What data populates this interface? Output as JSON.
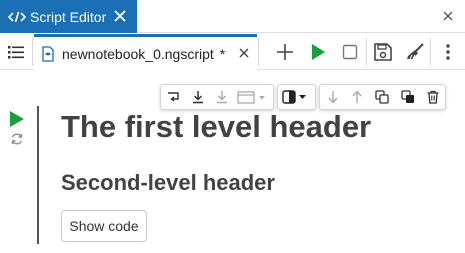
{
  "window": {
    "title": "Script Editor",
    "accent_color": "#1b6fb5",
    "title_icon": "code-icon"
  },
  "editor": {
    "file_name": "newnotebook_0.ngscript",
    "modified_marker": "*",
    "toolbar": {
      "icons": [
        "menu-icon",
        "add-icon",
        "run-icon",
        "stop-icon",
        "save-icon",
        "clean-icon",
        "more-vertical-icon"
      ],
      "run_color": "#1a9e3a"
    }
  },
  "cell": {
    "toolbar_icons": [
      "wrap-icon",
      "move-to-bottom-icon",
      "download-icon",
      "layout-dropdown-icon",
      "contrast-dropdown-icon",
      "move-down-icon",
      "move-up-icon",
      "copy-icon",
      "duplicate-icon",
      "delete-icon"
    ],
    "heading1": "The first level header",
    "heading2": "Second-level header",
    "show_code_label": "Show code"
  }
}
